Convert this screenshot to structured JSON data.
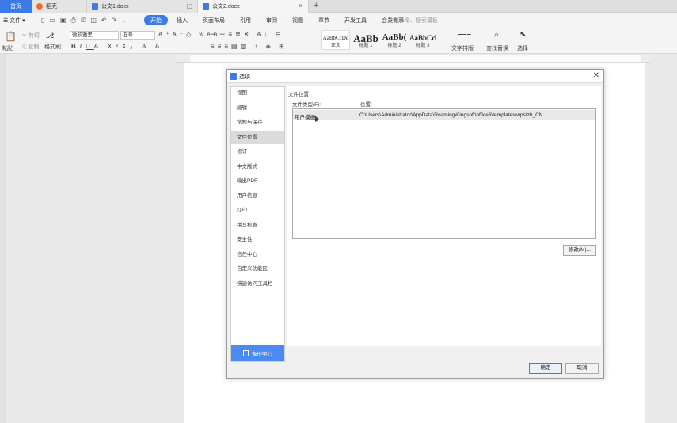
{
  "tabs": {
    "home": "首页",
    "daoke": "稻壳",
    "doc1": "公文1.docx",
    "doc2": "公文2.docx"
  },
  "menu": {
    "file": "文件",
    "items": [
      "开始",
      "插入",
      "页面布局",
      "引用",
      "审阅",
      "视图",
      "章节",
      "开发工具",
      "会员专享"
    ],
    "search": "查找命令、搜索模板"
  },
  "ribbon": {
    "paste": "粘贴",
    "cut": "剪切",
    "copy": "复制",
    "format_painter": "格式刷",
    "font_name": "微软雅黑",
    "font_size": "五号",
    "styles": [
      {
        "preview": "AaBbCcDd",
        "name": "正文"
      },
      {
        "preview": "AaBb",
        "name": "标题 1"
      },
      {
        "preview": "AaBb(",
        "name": "标题 2"
      },
      {
        "preview": "AaBbCcI",
        "name": "标题 3"
      }
    ],
    "text_layout": "文字排版",
    "find_replace": "查找替换",
    "select": "选择"
  },
  "dialog": {
    "title": "选项",
    "nav": [
      "视图",
      "编辑",
      "常规与保存",
      "文件位置",
      "修订",
      "中文版式",
      "输出PDF",
      "用户信息",
      "打印",
      "拼写检查",
      "安全性",
      "信任中心",
      "自定义功能区",
      "快速访问工具栏"
    ],
    "nav_selected_index": 3,
    "backup": "备份中心",
    "section_title": "文件位置",
    "col_type": "文件类型(F):",
    "col_location": "位置:",
    "rows": [
      {
        "type": "用户模板",
        "location": "C:\\Users\\Administrator\\AppData\\Roaming\\Kingsoft\\office6\\templates\\wps\\zh_CN"
      }
    ],
    "modify": "修改(M)...",
    "ok": "确定",
    "cancel": "取消"
  },
  "colors": {
    "accent": "#3b7be8",
    "orange": "#ef6a2b"
  }
}
